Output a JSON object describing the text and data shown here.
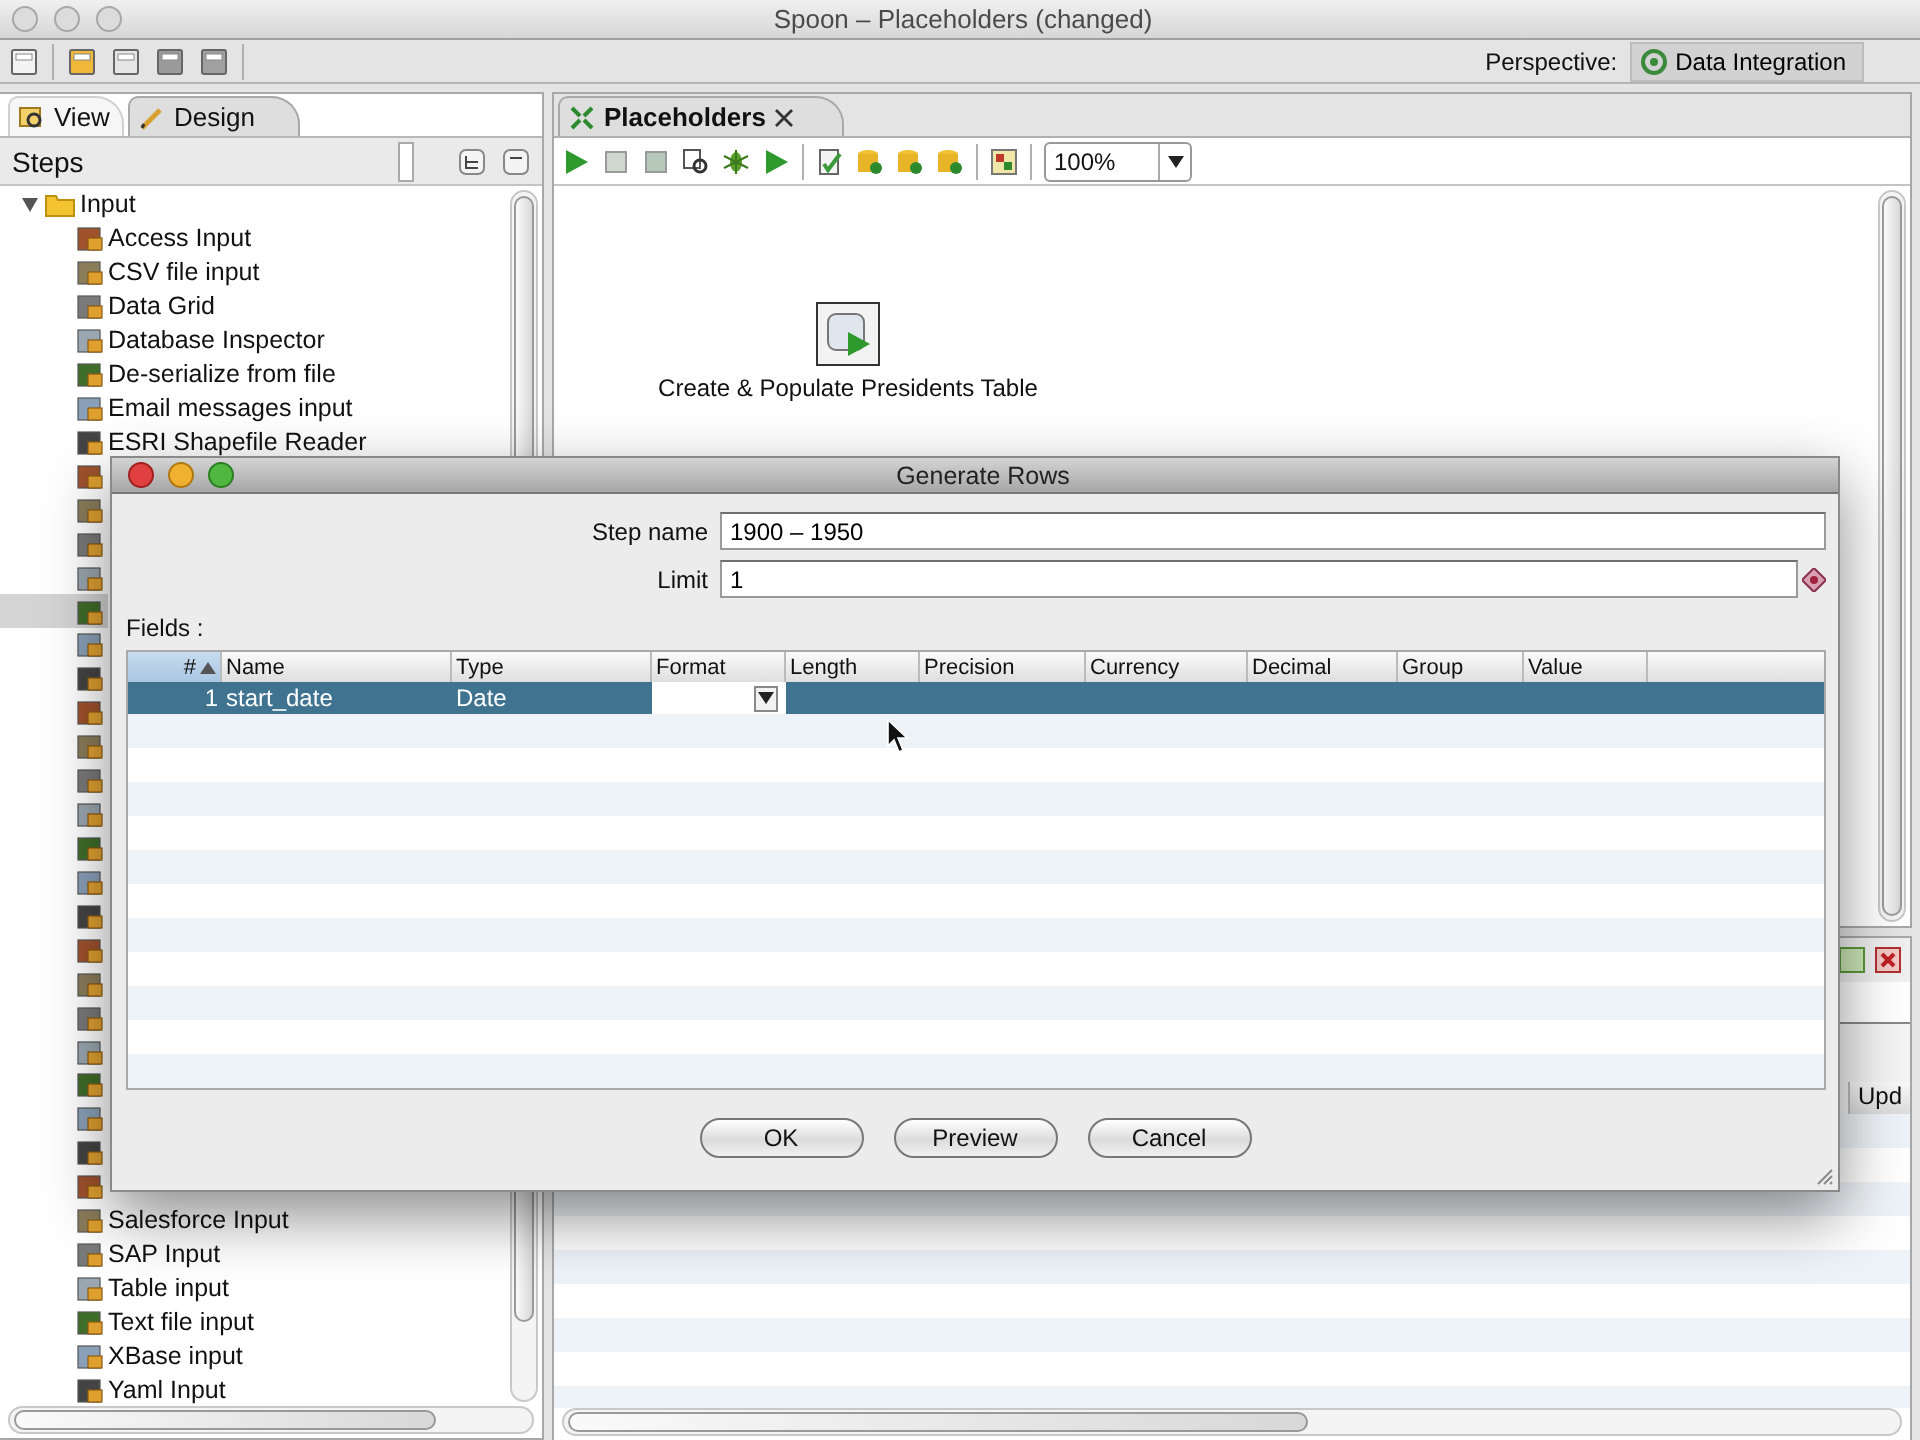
{
  "window": {
    "title": "Spoon – Placeholders (changed)"
  },
  "toolbar": {
    "perspective_label": "Perspective:",
    "perspective": "Data Integration"
  },
  "left_panel": {
    "tabs": [
      {
        "label": "View",
        "selected": false
      },
      {
        "label": "Design",
        "selected": true
      }
    ],
    "header": "Steps",
    "tree": [
      {
        "label": "Input",
        "expanded": true,
        "children": [
          {
            "kind": "step",
            "label": "Access Input",
            "selected": false
          },
          {
            "kind": "step",
            "label": "CSV file input",
            "selected": false
          },
          {
            "kind": "step",
            "label": "Data Grid",
            "selected": false
          },
          {
            "kind": "step",
            "label": "Database Inspector",
            "selected": false
          },
          {
            "kind": "step",
            "label": "De-serialize from file",
            "selected": false
          },
          {
            "kind": "step",
            "label": "Email messages input",
            "selected": false
          },
          {
            "kind": "step",
            "label": "ESRI Shapefile Reader",
            "selected": false
          },
          {
            "kind": "covered",
            "selected": false
          },
          {
            "kind": "covered",
            "selected": false
          },
          {
            "kind": "covered",
            "selected": false
          },
          {
            "kind": "covered",
            "selected": false
          },
          {
            "kind": "covered",
            "selected": true
          },
          {
            "kind": "covered",
            "selected": false
          },
          {
            "kind": "covered",
            "selected": false
          },
          {
            "kind": "covered",
            "selected": false
          },
          {
            "kind": "covered",
            "selected": false
          },
          {
            "kind": "covered",
            "selected": false
          },
          {
            "kind": "covered",
            "selected": false
          },
          {
            "kind": "covered",
            "selected": false
          },
          {
            "kind": "covered",
            "selected": false
          },
          {
            "kind": "covered",
            "selected": false
          },
          {
            "kind": "covered",
            "selected": false
          },
          {
            "kind": "covered",
            "selected": false
          },
          {
            "kind": "covered",
            "selected": false
          },
          {
            "kind": "covered",
            "selected": false
          },
          {
            "kind": "covered",
            "selected": false
          },
          {
            "kind": "covered",
            "selected": false
          },
          {
            "kind": "covered",
            "selected": false
          },
          {
            "kind": "covered",
            "selected": false
          },
          {
            "kind": "step",
            "label": "Salesforce Input",
            "selected": false
          },
          {
            "kind": "step",
            "label": "SAP Input",
            "selected": false
          },
          {
            "kind": "step",
            "label": "Table input",
            "selected": false
          },
          {
            "kind": "step",
            "label": "Text file input",
            "selected": false
          },
          {
            "kind": "step",
            "label": "XBase input",
            "selected": false
          },
          {
            "kind": "step",
            "label": "Yaml Input",
            "selected": false
          }
        ]
      }
    ]
  },
  "editor": {
    "tabs": [
      {
        "label": "Placeholders",
        "selected": true
      }
    ],
    "zoom": "100%",
    "steps": [
      {
        "label": "Create & Populate Presidents Table"
      }
    ],
    "results": {
      "columns": [
        "Upd"
      ]
    }
  },
  "dialog": {
    "title": "Generate Rows",
    "step_name_label": "Step name",
    "step_name": "1900 – 1950",
    "limit_label": "Limit",
    "limit": "1",
    "fields_label": "Fields :",
    "columns": [
      "#",
      "Name",
      "Type",
      "Format",
      "Length",
      "Precision",
      "Currency",
      "Decimal",
      "Group",
      "Value"
    ],
    "rows": [
      {
        "number": "1",
        "name": "start_date",
        "type": "Date",
        "selected": true
      }
    ],
    "buttons": [
      "OK",
      "Preview",
      "Cancel"
    ]
  }
}
